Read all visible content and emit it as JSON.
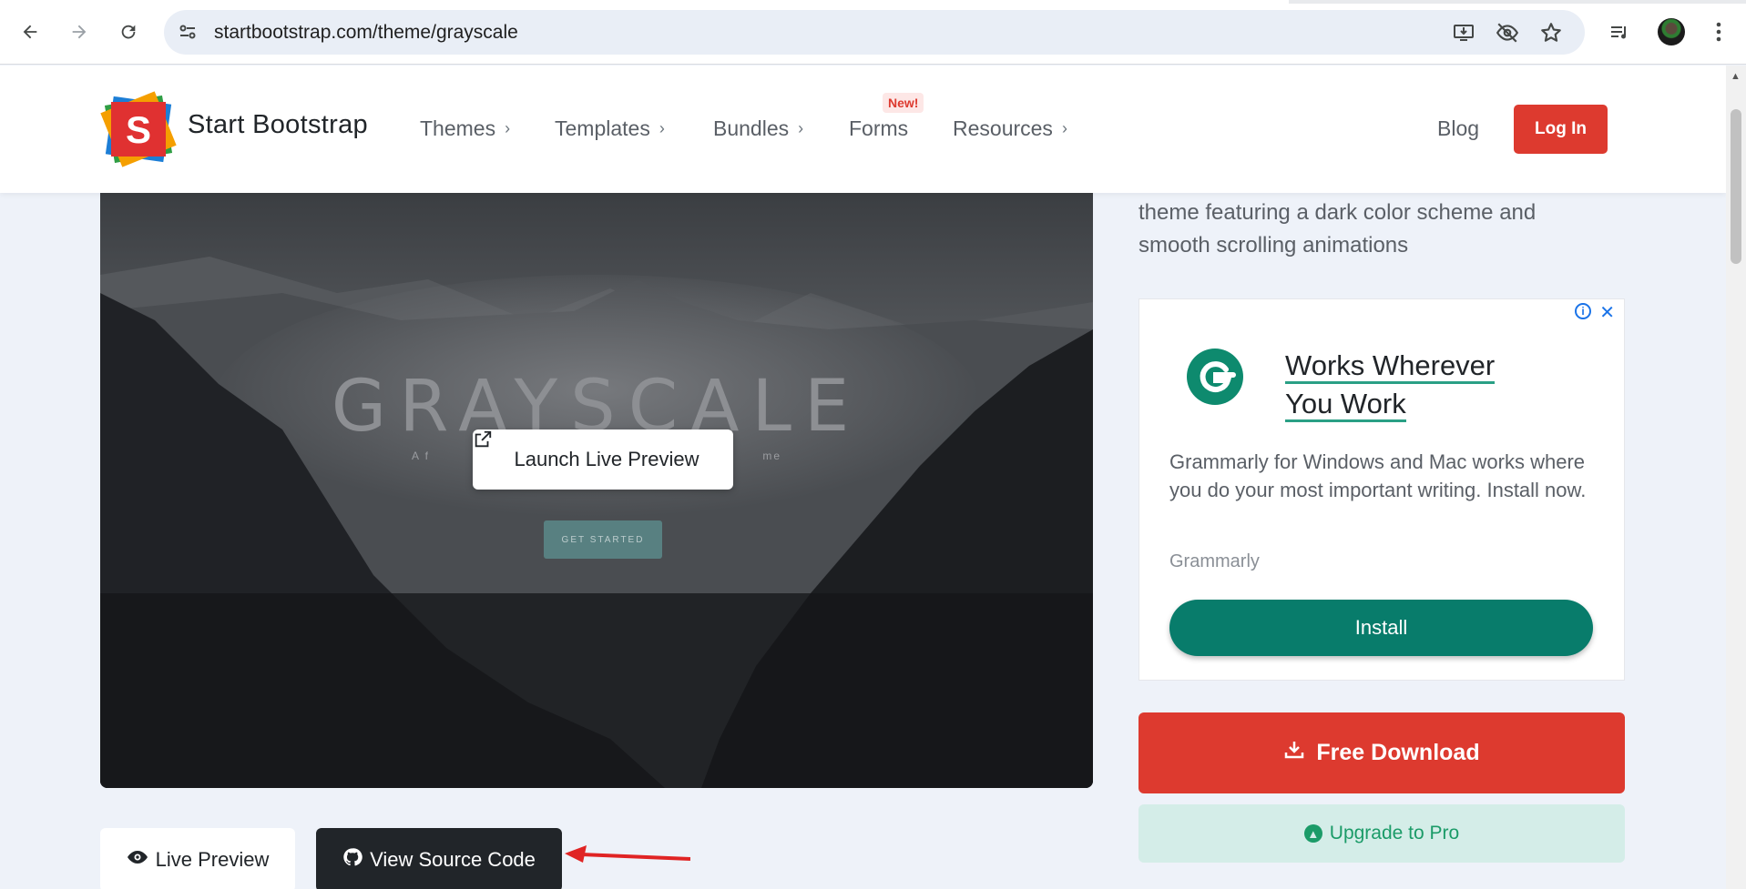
{
  "browser": {
    "url": "startbootstrap.com/theme/grayscale",
    "icons": [
      "back-arrow-icon",
      "forward-arrow-icon",
      "reload-icon",
      "site-info-icon",
      "install-app-icon",
      "eye-off-icon",
      "star-icon",
      "reading-list-icon",
      "profile-avatar-icon",
      "more-menu-icon"
    ]
  },
  "nav": {
    "brand": "Start Bootstrap",
    "logo_letter": "S",
    "items": [
      {
        "label": "Themes",
        "has_chevron": true
      },
      {
        "label": "Templates",
        "has_chevron": true
      },
      {
        "label": "Bundles",
        "has_chevron": true
      },
      {
        "label": "Forms",
        "has_chevron": false
      },
      {
        "label": "Resources",
        "has_chevron": true
      }
    ],
    "new_badge": "New!",
    "blog": "Blog",
    "login": "Log In"
  },
  "preview": {
    "title": "GRAYSCALE",
    "subtitle_left": "A f",
    "subtitle_right": "me",
    "launch": "Launch Live Preview",
    "get_started": "GET STARTED"
  },
  "actions": {
    "live_preview": "Live Preview",
    "view_source": "View Source Code"
  },
  "description": "theme featuring a dark color scheme and smooth scrolling animations",
  "ad": {
    "headline_line1": "Works Wherever",
    "headline_line2": "You Work",
    "body": "Grammarly for Windows and Mac works where you do your most important writing. Install now.",
    "advertiser": "Grammarly",
    "cta": "Install",
    "adchoices_glyph": "i",
    "close_glyph": "✕"
  },
  "sidebar_actions": {
    "free_download": "Free Download",
    "upgrade": "Upgrade to Pro"
  },
  "colors": {
    "brand_red": "#dd3a2f",
    "grammarly_green": "#087c6b",
    "upgrade_green": "#1b9b68",
    "dark_button": "#212529",
    "annotation_arrow": "#e02424"
  }
}
